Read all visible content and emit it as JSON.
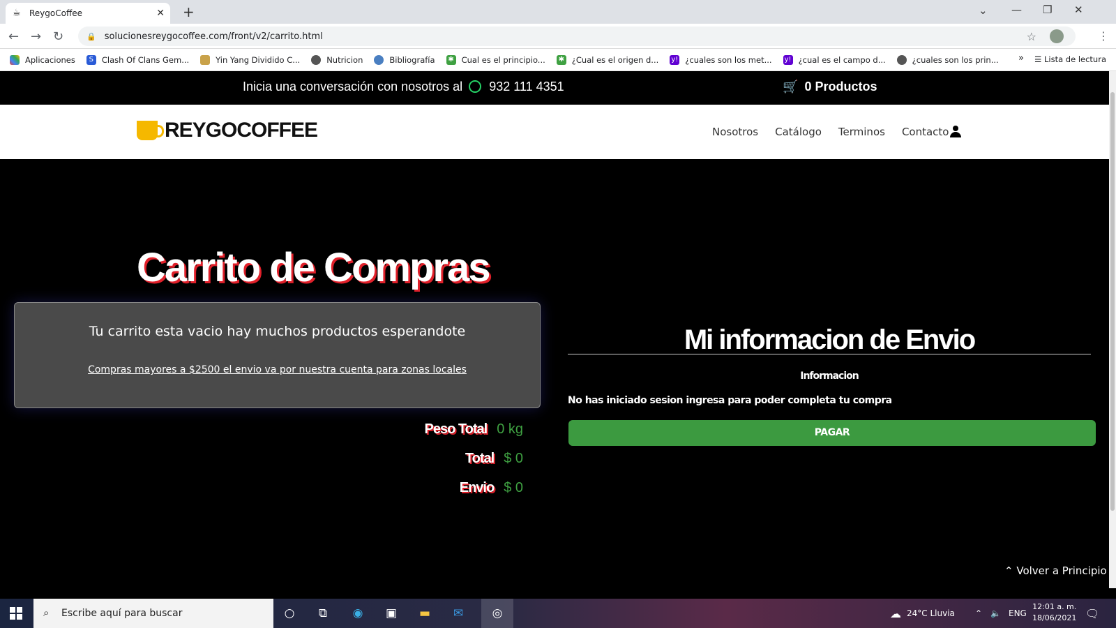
{
  "browser": {
    "tab_title": "ReygoCoffee",
    "url": "solucionesreygocoffee.com/front/v2/carrito.html",
    "bookmarks": [
      "Aplicaciones",
      "Clash Of Clans Gem...",
      "Yin Yang Dividido C...",
      "Nutricion",
      "Bibliografía",
      "Cual es el principio...",
      "¿Cual es el origen d...",
      "¿cuales son los met...",
      "¿cual es el campo d...",
      "¿cuales son los prin..."
    ],
    "reading_list": "Lista de lectura"
  },
  "topbar": {
    "conversation": "Inicia una conversación con nosotros al",
    "phone": "932 111 4351",
    "cart": "0 Productos"
  },
  "header": {
    "logo": "REYGOCOFFEE",
    "logo_shadow": "COFFEE",
    "menu": [
      "Nosotros",
      "Catálogo",
      "Terminos",
      "Contacto"
    ]
  },
  "cart": {
    "title": "Carrito de Compras",
    "empty_msg": "Tu carrito esta vacio hay muchos productos esperandote",
    "shipping_note": "Compras mayores a $2500 el envio va por nuestra cuenta para zonas locales",
    "weight_label": "Peso Total",
    "weight_value": "0 kg",
    "total_label": "Total",
    "total_value": "$ 0",
    "shipping_label": "Envio",
    "shipping_value": "$ 0"
  },
  "shipping_info": {
    "title": "Mi informacion de Envio",
    "subtitle": "Informacion",
    "not_logged": "No has iniciado sesion ingresa para poder completa tu compra",
    "pay_button": "PAGAR"
  },
  "back_to_top": "Volver a Principio",
  "taskbar": {
    "search_placeholder": "Escribe aquí para buscar",
    "weather": "24°C  Lluvia",
    "lang": "ENG",
    "time": "12:01 a. m.",
    "date": "18/06/2021"
  },
  "colors": {
    "accent_red": "#e0202a",
    "green": "#3fa142",
    "logo_yellow": "#f5b800"
  }
}
